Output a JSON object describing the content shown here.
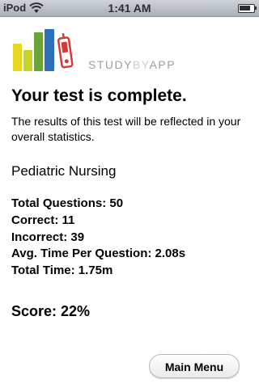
{
  "status_bar": {
    "carrier": "iPod",
    "time": "1:41 AM",
    "wifi_icon": "wifi-icon",
    "battery_icon": "battery-icon",
    "battery_level": 0.85
  },
  "logo": {
    "text_part1": "STUDY",
    "text_part2": "BY",
    "text_part3": "APP",
    "colors": [
      "#e6d820",
      "#a6c43a",
      "#6aa437",
      "#2d6fb8",
      "#d43a3a"
    ]
  },
  "results": {
    "heading": "Your test is complete.",
    "description": "The results of this test will be reflected in your overall statistics.",
    "subject": "Pediatric Nursing",
    "stats": [
      "Total Questions: 50",
      "Correct: 11",
      "Incorrect: 39",
      "Avg. Time Per Question: 2.08s",
      "Total Time: 1.75m"
    ],
    "score": "Score: 22%"
  },
  "actions": {
    "main_menu_label": "Main Menu"
  }
}
